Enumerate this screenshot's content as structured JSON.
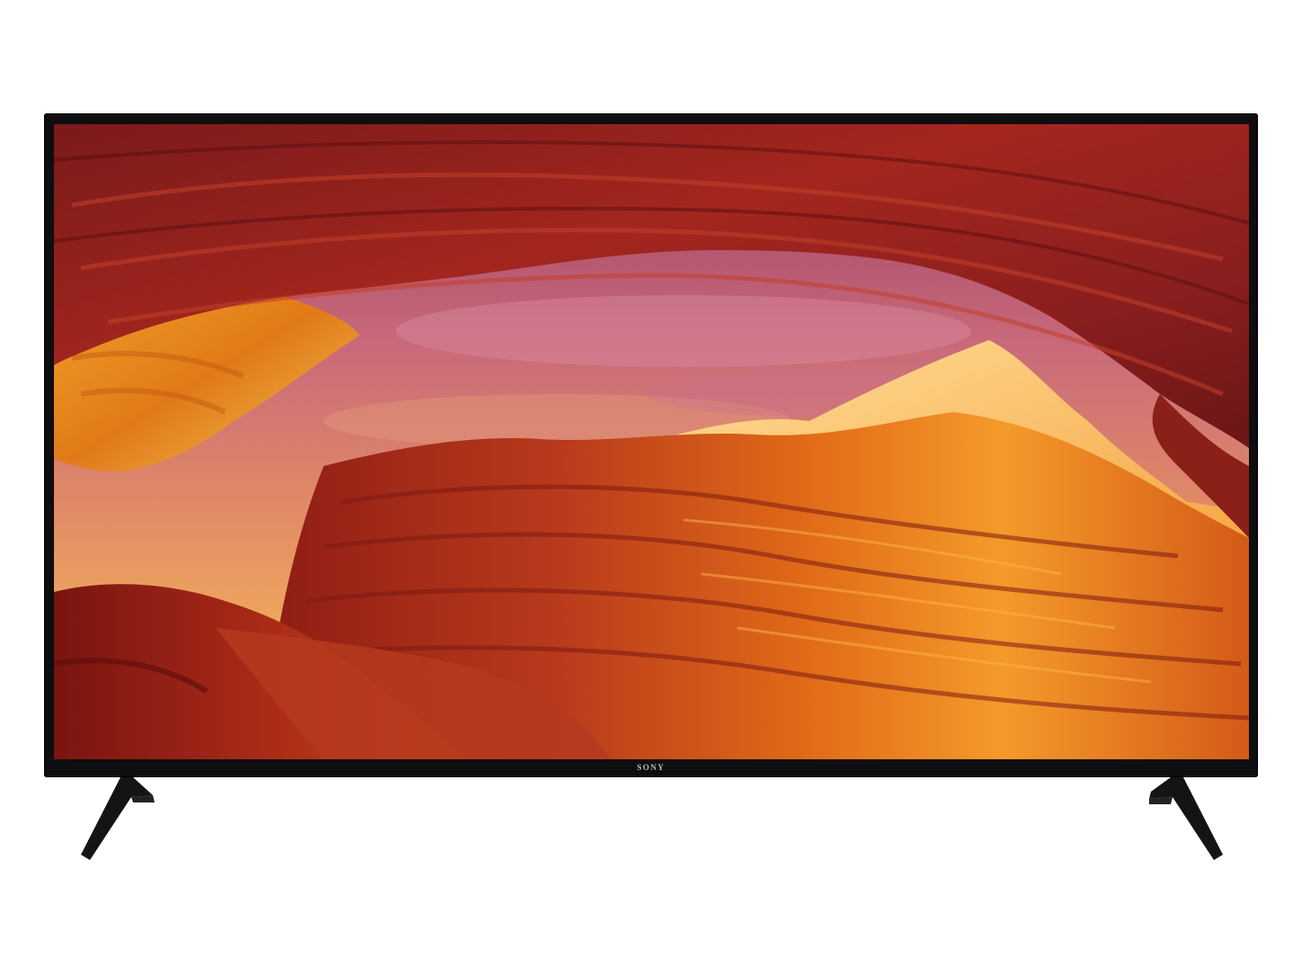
{
  "product": {
    "brand_logo": "SONY"
  },
  "colors": {
    "bezel": "#0e0e10",
    "sky_top": "#b0506a",
    "sky_bottom": "#f2a24a",
    "rock_dark": "#6a1414",
    "rock_mid": "#b8341c",
    "rock_bright": "#f07a1c",
    "rock_glow": "#ffd07a"
  }
}
